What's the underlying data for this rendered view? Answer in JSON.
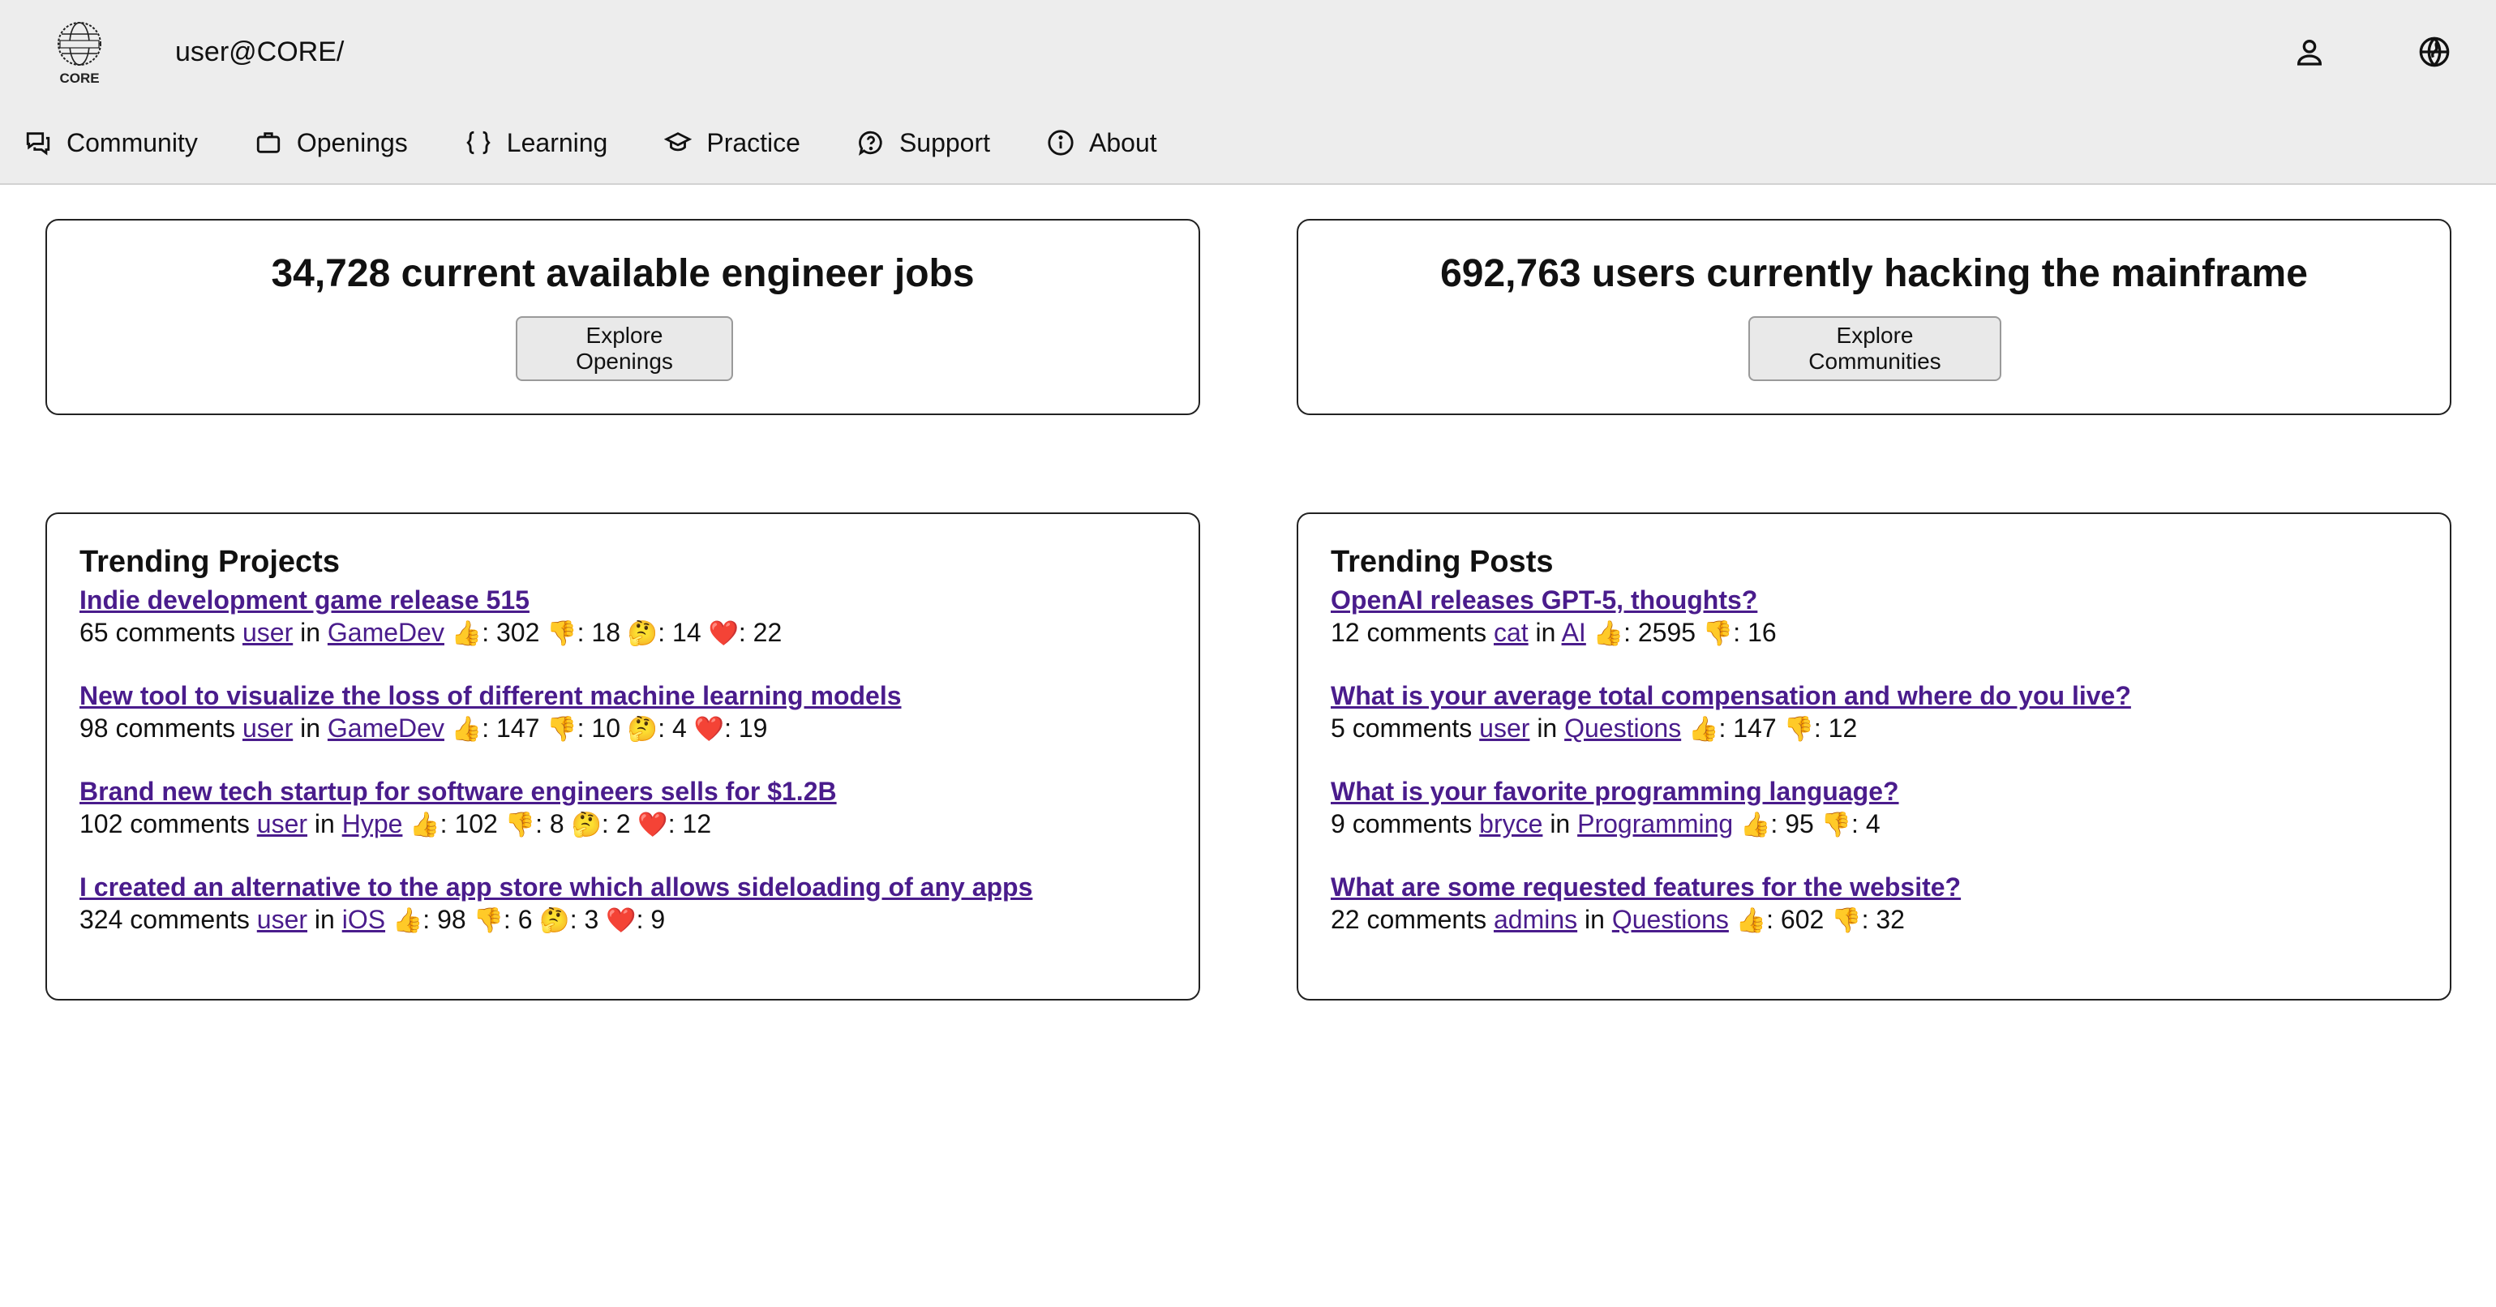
{
  "header": {
    "logo_text": "CORE",
    "prompt": "user@CORE/",
    "icons": [
      "user-icon",
      "globe-icon"
    ]
  },
  "nav": [
    {
      "label": "Community",
      "icon": "chat-icon"
    },
    {
      "label": "Openings",
      "icon": "briefcase-icon"
    },
    {
      "label": "Learning",
      "icon": "braces-icon"
    },
    {
      "label": "Practice",
      "icon": "graduation-cap-icon"
    },
    {
      "label": "Support",
      "icon": "help-circle-icon"
    },
    {
      "label": "About",
      "icon": "info-icon"
    }
  ],
  "stats": {
    "jobs": {
      "title": "34,728 current available engineer jobs",
      "button": "Explore Openings"
    },
    "users": {
      "title": "692,763 users currently hacking the mainframe",
      "button": "Explore Communities"
    }
  },
  "trending_projects": {
    "title": "Trending Projects",
    "items": [
      {
        "title": "Indie development game release 515",
        "comments": "65 comments",
        "user": "user",
        "in": "in",
        "community": "GameDev",
        "up": "302",
        "down": "18",
        "think": "14",
        "heart": "22"
      },
      {
        "title": "New tool to visualize the loss of different machine learning models",
        "comments": "98 comments",
        "user": "user",
        "in": "in",
        "community": "GameDev",
        "up": "147",
        "down": "10",
        "think": "4",
        "heart": "19"
      },
      {
        "title": "Brand new tech startup for software engineers sells for $1.2B",
        "comments": "102 comments",
        "user": "user",
        "in": "in",
        "community": "Hype",
        "up": "102",
        "down": "8",
        "think": "2",
        "heart": "12"
      },
      {
        "title": "I created an alternative to the app store which allows sideloading of any apps",
        "comments": "324 comments",
        "user": "user",
        "in": "in",
        "community": "iOS",
        "up": "98",
        "down": "6",
        "think": "3",
        "heart": "9"
      }
    ]
  },
  "trending_posts": {
    "title": "Trending Posts",
    "items": [
      {
        "title": "OpenAI releases GPT-5, thoughts?",
        "comments": "12 comments",
        "user": "cat",
        "in": "in",
        "community": "AI",
        "up": "2595",
        "down": "16"
      },
      {
        "title": "What is your average total compensation and where do you live?",
        "comments": "5 comments",
        "user": "user",
        "in": "in",
        "community": "Questions",
        "up": "147",
        "down": "12"
      },
      {
        "title": "What is your favorite programming language?",
        "comments": "9 comments",
        "user": "bryce",
        "in": "in",
        "community": "Programming",
        "up": "95",
        "down": "4"
      },
      {
        "title": "What are some requested features for the website?",
        "comments": "22 comments",
        "user": "admins",
        "in": "in",
        "community": "Questions",
        "up": "602",
        "down": "32"
      }
    ]
  },
  "reactions": {
    "up": "👍",
    "down": "👎",
    "think": "🤔",
    "heart": "❤️"
  },
  "colors": {
    "link": "#4a1c8c",
    "header_bg": "#ededed",
    "border": "#222222"
  }
}
